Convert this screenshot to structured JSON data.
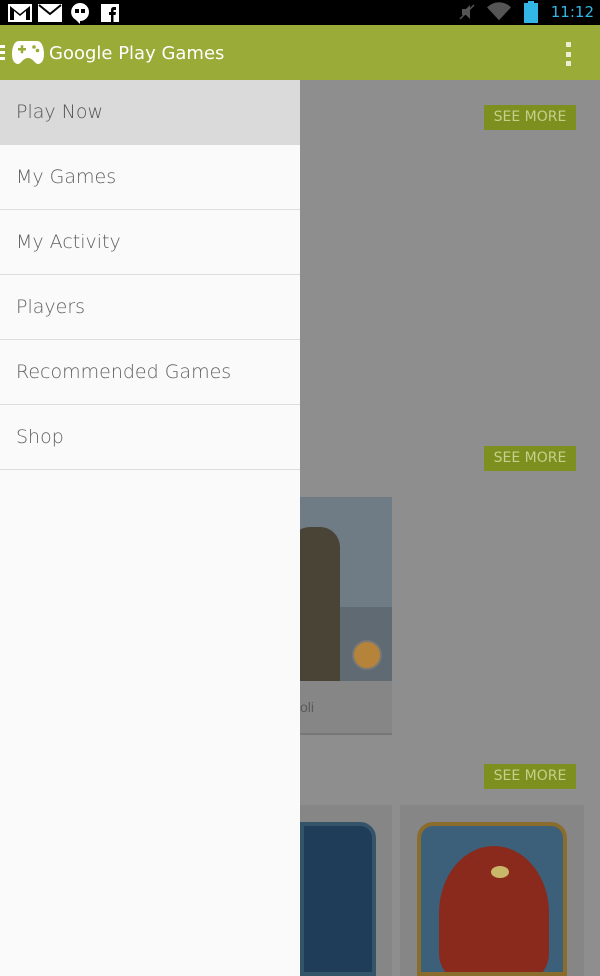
{
  "status_bar": {
    "time": "11:12",
    "icons": [
      "gmail-icon",
      "email-icon",
      "hangouts-icon",
      "facebook-icon",
      "mute-icon",
      "wifi-icon",
      "battery-icon"
    ]
  },
  "app_bar": {
    "title": "Google Play Games",
    "color": "#9aab37"
  },
  "drawer": {
    "items": [
      {
        "label": "Play Now",
        "active": true
      },
      {
        "label": "My Games",
        "active": false
      },
      {
        "label": "My Activity",
        "active": false
      },
      {
        "label": "Players",
        "active": false
      },
      {
        "label": "Recommended Games",
        "active": false
      },
      {
        "label": "Shop",
        "active": false
      }
    ]
  },
  "content": {
    "see_more_label": "SEE MORE",
    "player_card_caption": "oli"
  }
}
